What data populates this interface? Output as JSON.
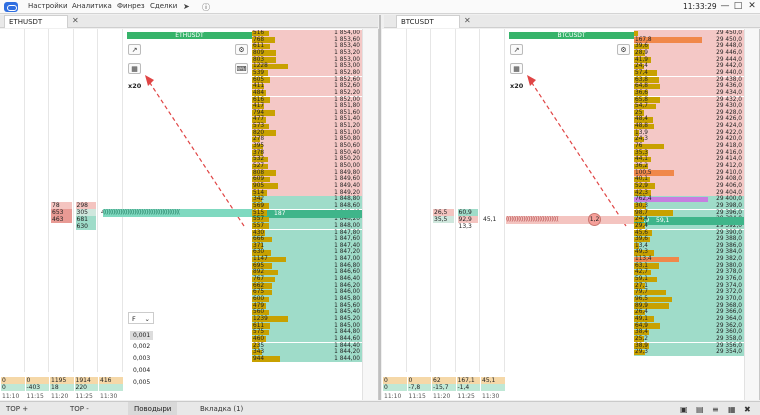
{
  "topbar": {
    "menu": [
      "Настройки",
      "Аналитика",
      "Финрез",
      "Сделки"
    ],
    "clock": "11:33:29"
  },
  "left": {
    "tab": "ETHUSDT",
    "title": "ETHUSDT",
    "zoom": "x20",
    "time_labels": [
      "11:10",
      "11:15",
      "11:20",
      "11:25",
      "11:30"
    ],
    "vol_cells": [
      {
        "col": 2,
        "row": 0,
        "text": "78",
        "kind": "ask"
      },
      {
        "col": 3,
        "row": 0,
        "text": "298",
        "kind": "ask"
      },
      {
        "col": 2,
        "row": 1,
        "text": "653",
        "kind": "askd"
      },
      {
        "col": 3,
        "row": 1,
        "text": "305",
        "kind": "mid"
      },
      {
        "col": 4,
        "row": 1,
        "text": "416",
        "kind": "plain"
      },
      {
        "col": 2,
        "row": 2,
        "text": "463",
        "kind": "askd"
      },
      {
        "col": 3,
        "row": 2,
        "text": "681",
        "kind": "bid"
      },
      {
        "col": 3,
        "row": 3,
        "text": "630",
        "kind": "bid"
      }
    ],
    "foot": [
      [
        "0",
        "0",
        "1195",
        "1914",
        "416"
      ],
      [
        "0",
        "-403",
        "18",
        "220",
        ""
      ]
    ],
    "cluster": "((((((((((((((((((((((((((((((((((((((((((((",
    "cur_bid": "162",
    "cur_ask": "187",
    "ladder": [
      [
        "516",
        "1 854,00",
        0.22,
        "a"
      ],
      [
        "768",
        "1 853,60",
        0.3,
        "a"
      ],
      [
        "611",
        "1 853,40",
        0.24,
        "a"
      ],
      [
        "809",
        "1 853,20",
        0.32,
        "a"
      ],
      [
        "803",
        "1 853,00",
        0.32,
        "a"
      ],
      [
        "1228",
        "1 853,00",
        0.48,
        "a"
      ],
      [
        "539",
        "1 852,80",
        0.21,
        "a"
      ],
      [
        "605",
        "1 852,60",
        0.24,
        "a"
      ],
      [
        "411",
        "1 852,60",
        0.16,
        "a"
      ],
      [
        "484",
        "1 852,20",
        0.19,
        "a"
      ],
      [
        "616",
        "1 852,00",
        0.24,
        "a"
      ],
      [
        "417",
        "1 851,80",
        0.16,
        "a"
      ],
      [
        "794",
        "1 851,60",
        0.31,
        "a"
      ],
      [
        "477",
        "1 851,40",
        0.19,
        "a"
      ],
      [
        "573",
        "1 851,20",
        0.22,
        "a"
      ],
      [
        "820",
        "1 851,00",
        0.32,
        "a"
      ],
      [
        "278",
        "1 850,80",
        0.11,
        "a"
      ],
      [
        "395",
        "1 850,60",
        0.15,
        "a"
      ],
      [
        "378",
        "1 850,40",
        0.15,
        "a"
      ],
      [
        "532",
        "1 850,20",
        0.21,
        "a"
      ],
      [
        "527",
        "1 850,00",
        0.21,
        "a"
      ],
      [
        "808",
        "1 849,80",
        0.32,
        "a"
      ],
      [
        "609",
        "1 849,60",
        0.24,
        "a"
      ],
      [
        "905",
        "1 849,40",
        0.35,
        "a"
      ],
      [
        "514",
        "1 849,20",
        0.2,
        "a"
      ],
      [
        "342",
        "1 848,80",
        0.13,
        "b"
      ],
      [
        "569",
        "1 848,60",
        0.22,
        "b"
      ],
      [
        "515",
        "1 848,40",
        0.2,
        "b"
      ],
      [
        "557",
        "1 848,20",
        0.22,
        "b"
      ],
      [
        "557",
        "1 848,00",
        0.22,
        "b"
      ],
      [
        "430",
        "1 847,80",
        0.17,
        "b"
      ],
      [
        "666",
        "1 847,60",
        0.26,
        "b"
      ],
      [
        "371",
        "1 847,40",
        0.14,
        "b"
      ],
      [
        "630",
        "1 847,20",
        0.25,
        "b"
      ],
      [
        "1147",
        "1 847,00",
        0.45,
        "b"
      ],
      [
        "695",
        "1 846,80",
        0.27,
        "b"
      ],
      [
        "892",
        "1 846,60",
        0.35,
        "b"
      ],
      [
        "767",
        "1 846,40",
        0.3,
        "b"
      ],
      [
        "662",
        "1 846,20",
        0.26,
        "b"
      ],
      [
        "675",
        "1 846,00",
        0.26,
        "b"
      ],
      [
        "600",
        "1 845,80",
        0.23,
        "b"
      ],
      [
        "479",
        "1 845,60",
        0.19,
        "b"
      ],
      [
        "560",
        "1 845,40",
        0.22,
        "b"
      ],
      [
        "1239",
        "1 845,20",
        0.48,
        "b"
      ],
      [
        "611",
        "1 845,00",
        0.24,
        "b"
      ],
      [
        "575",
        "1 844,80",
        0.22,
        "b"
      ],
      [
        "460",
        "1 844,60",
        0.18,
        "b"
      ],
      [
        "235",
        "1 844,40",
        0.09,
        "b"
      ],
      [
        "343",
        "1 844,20",
        0.13,
        "b"
      ],
      [
        "944",
        "1 844,00",
        0.37,
        "b"
      ]
    ],
    "select_f": "F",
    "multipliers": [
      "0,001",
      "0,002",
      "0,003",
      "0,004",
      "0,005"
    ]
  },
  "right": {
    "tab": "BTCUSDT",
    "title": "BTCUSDT",
    "zoom": "x20",
    "time_labels": [
      "11:10",
      "11:15",
      "11:20",
      "11:25",
      "11:30"
    ],
    "vol_cells": [
      {
        "col": 2,
        "row": 1,
        "text": "26,5",
        "kind": "ask"
      },
      {
        "col": 3,
        "row": 1,
        "text": "60,9",
        "kind": "bid"
      },
      {
        "col": 2,
        "row": 2,
        "text": "35,5",
        "kind": "mid"
      },
      {
        "col": 3,
        "row": 2,
        "text": "92,9",
        "kind": "ask"
      },
      {
        "col": 4,
        "row": 2,
        "text": "45,1",
        "kind": "plain"
      },
      {
        "col": 3,
        "row": 3,
        "text": "13,3",
        "kind": "plain"
      }
    ],
    "foot": [
      [
        "0",
        "0",
        "62",
        "167,1",
        "45,1"
      ],
      [
        "0",
        "-7,8",
        "-15,7",
        "-1,4",
        ""
      ]
    ],
    "cluster": "((((((((((((((((((((((((((((((",
    "bubble": "1,2",
    "cur_bid": "22,9",
    "cur_ask": "59,1",
    "ladder": [
      [
        "",
        "29 450,0",
        0.05,
        "a"
      ],
      [
        "167,8",
        "29 450,0",
        0.9,
        "ao"
      ],
      [
        "39,6",
        "29 448,0",
        0.2,
        "a"
      ],
      [
        "28,9",
        "29 446,0",
        0.15,
        "a"
      ],
      [
        "41,9",
        "29 444,0",
        0.22,
        "a"
      ],
      [
        "24,4",
        "29 442,0",
        0.13,
        "a"
      ],
      [
        "57,4",
        "29 440,0",
        0.3,
        "a"
      ],
      [
        "63,8",
        "29 438,0",
        0.33,
        "a"
      ],
      [
        "64,8",
        "29 436,0",
        0.34,
        "a"
      ],
      [
        "36,6",
        "29 434,0",
        0.19,
        "a"
      ],
      [
        "65,8",
        "29 432,0",
        0.34,
        "a"
      ],
      [
        "54,7",
        "29 430,0",
        0.29,
        "a"
      ],
      [
        "25",
        "29 428,0",
        0.13,
        "a"
      ],
      [
        "48,4",
        "29 426,0",
        0.25,
        "a"
      ],
      [
        "48,8",
        "29 424,0",
        0.26,
        "a"
      ],
      [
        "13,9",
        "29 422,0",
        0.07,
        "a"
      ],
      [
        "24,3",
        "29 420,0",
        0.13,
        "a"
      ],
      [
        "76",
        "29 418,0",
        0.4,
        "a"
      ],
      [
        "35,3",
        "29 416,0",
        0.19,
        "a"
      ],
      [
        "44,1",
        "29 414,0",
        0.23,
        "a"
      ],
      [
        "36,2",
        "29 412,0",
        0.19,
        "a"
      ],
      [
        "100,5",
        "29 410,0",
        0.53,
        "ao"
      ],
      [
        "40,1",
        "29 408,0",
        0.21,
        "a"
      ],
      [
        "52,9",
        "29 406,0",
        0.28,
        "a"
      ],
      [
        "42,3",
        "29 404,0",
        0.22,
        "a"
      ],
      [
        "762,4",
        "29 400,0",
        0.99,
        "bp"
      ],
      [
        "30,3",
        "29 398,0",
        0.16,
        "b"
      ],
      [
        "98,7",
        "29 396,0",
        0.52,
        "b"
      ],
      [
        "24,4",
        "29 394,0",
        0.13,
        "b"
      ],
      [
        "29,4",
        "29 392,0",
        0.15,
        "b"
      ],
      [
        "45,6",
        "29 390,0",
        0.24,
        "b"
      ],
      [
        "39,6",
        "29 388,0",
        0.21,
        "b"
      ],
      [
        "13,4",
        "29 386,0",
        0.07,
        "b"
      ],
      [
        "49,3",
        "29 384,0",
        0.26,
        "b"
      ],
      [
        "113,4",
        "29 382,0",
        0.6,
        "bo"
      ],
      [
        "63,1",
        "29 380,0",
        0.33,
        "b"
      ],
      [
        "42,7",
        "29 378,0",
        0.22,
        "b"
      ],
      [
        "59,1",
        "29 376,0",
        0.31,
        "b"
      ],
      [
        "27,1",
        "29 374,0",
        0.14,
        "b"
      ],
      [
        "79,7",
        "29 372,0",
        0.42,
        "b"
      ],
      [
        "96,5",
        "29 370,0",
        0.51,
        "b"
      ],
      [
        "89,9",
        "29 368,0",
        0.47,
        "b"
      ],
      [
        "26,4",
        "29 366,0",
        0.14,
        "b"
      ],
      [
        "49,1",
        "29 364,0",
        0.26,
        "b"
      ],
      [
        "64,9",
        "29 362,0",
        0.34,
        "b"
      ],
      [
        "38,4",
        "29 360,0",
        0.2,
        "b"
      ],
      [
        "25,2",
        "29 358,0",
        0.13,
        "b"
      ],
      [
        "38,9",
        "29 356,0",
        0.2,
        "b"
      ],
      [
        "29,3",
        "29 354,0",
        0.15,
        "b"
      ]
    ]
  },
  "bottom": {
    "tabs": [
      "TOP +",
      "TOP -",
      "Поводыри",
      "Вкладка (1)"
    ]
  }
}
